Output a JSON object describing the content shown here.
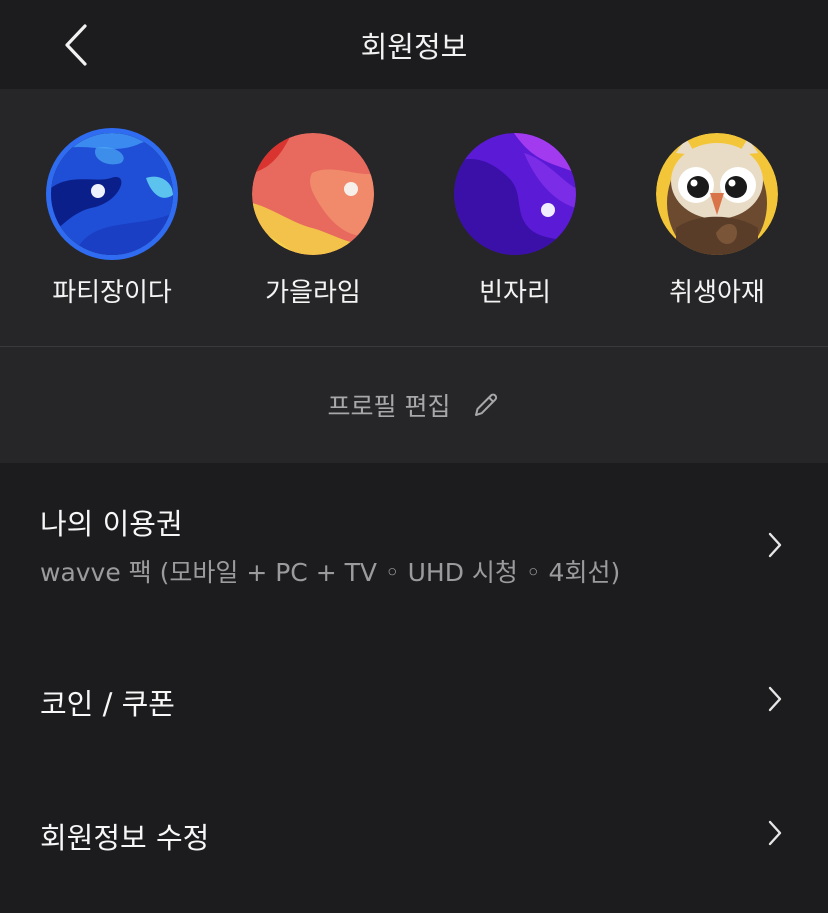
{
  "header": {
    "title": "회원정보",
    "back_icon": "chevron-left-icon"
  },
  "profiles": [
    {
      "name": "파티장이다",
      "avatar": "blue-planet-avatar",
      "selected": true
    },
    {
      "name": "가을라임",
      "avatar": "coral-planet-avatar",
      "selected": false
    },
    {
      "name": "빈자리",
      "avatar": "purple-planet-avatar",
      "selected": false
    },
    {
      "name": "취생아재",
      "avatar": "owl-avatar",
      "selected": false
    }
  ],
  "edit_profile": {
    "label": "프로필 편집",
    "icon": "pencil-icon"
  },
  "menu": {
    "items": [
      {
        "title": "나의 이용권",
        "subtitle": "wavve 팩 (모바일 + PC + TV ◦ UHD 시청 ◦ 4회선)",
        "icon": "chevron-right-icon"
      },
      {
        "title": "코인 / 쿠폰",
        "icon": "chevron-right-icon"
      },
      {
        "title": "회원정보 수정",
        "icon": "chevron-right-icon"
      }
    ]
  },
  "colors": {
    "background": "#1c1c1e",
    "panel": "#262628",
    "accent": "#2f6cf2"
  }
}
